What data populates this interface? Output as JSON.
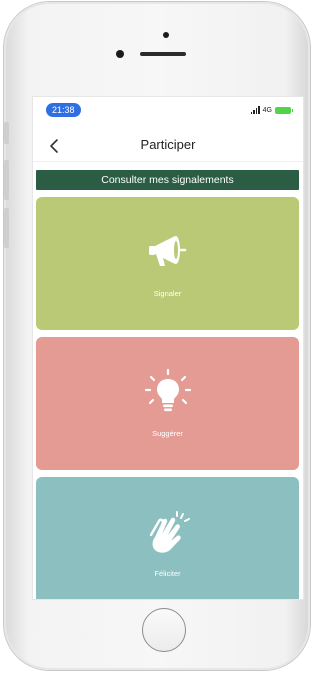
{
  "status_bar": {
    "time": "21:38",
    "network": "4G"
  },
  "header": {
    "title": "Participer"
  },
  "banner": {
    "label": "Consulter mes signalements",
    "color": "#2a5d43"
  },
  "tiles": [
    {
      "label": "Signaler",
      "icon": "megaphone-icon",
      "color": "#b9c975"
    },
    {
      "label": "Suggérer",
      "icon": "lightbulb-icon",
      "color": "#e49b93"
    },
    {
      "label": "Féliciter",
      "icon": "clapping-hands-icon",
      "color": "#8bbfc0"
    }
  ],
  "colors": {
    "time_pill": "#2f6fe4",
    "battery": "#52d34a"
  }
}
